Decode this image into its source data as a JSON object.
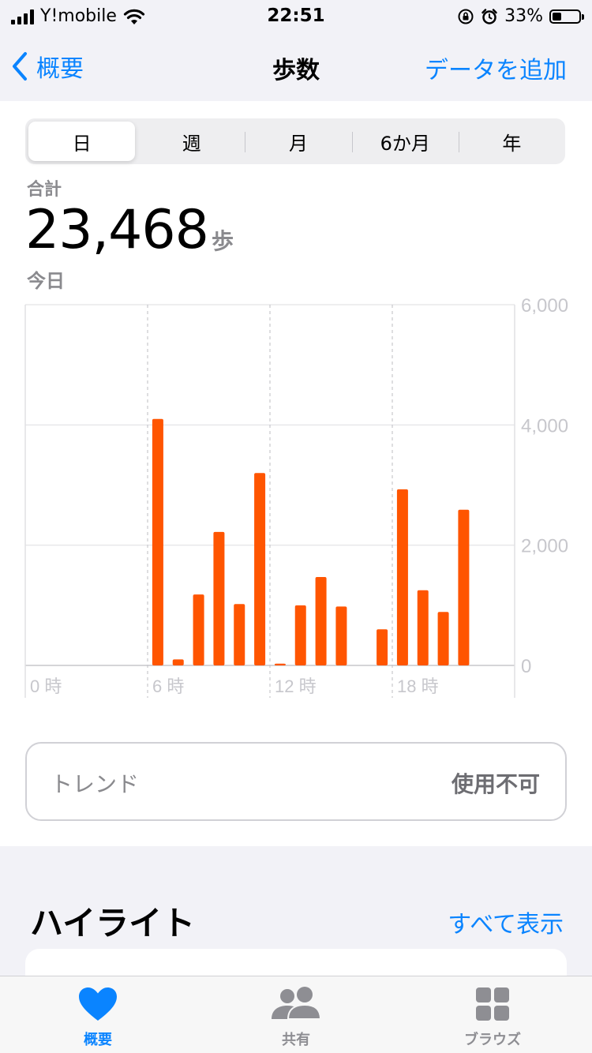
{
  "status_bar": {
    "carrier": "Y!mobile",
    "time": "22:51",
    "battery_percent": "33%",
    "battery_level": 0.33,
    "icons": [
      "signal-icon",
      "wifi-icon",
      "rotation-lock-icon",
      "alarm-icon",
      "battery-icon"
    ]
  },
  "nav": {
    "back_label": "概要",
    "title": "歩数",
    "action_label": "データを追加"
  },
  "segments": [
    {
      "label": "日",
      "active": true
    },
    {
      "label": "週",
      "active": false
    },
    {
      "label": "月",
      "active": false
    },
    {
      "label": "6か月",
      "active": false
    },
    {
      "label": "年",
      "active": false
    }
  ],
  "summary": {
    "label": "合計",
    "value": "23,468",
    "unit": "歩",
    "date": "今日"
  },
  "chart_data": {
    "type": "bar",
    "categories": [
      "0",
      "1",
      "2",
      "3",
      "4",
      "5",
      "6",
      "7",
      "8",
      "9",
      "10",
      "11",
      "12",
      "13",
      "14",
      "15",
      "16",
      "17",
      "18",
      "19",
      "20",
      "21",
      "22",
      "23"
    ],
    "values": [
      0,
      0,
      0,
      0,
      0,
      0,
      4100,
      100,
      1180,
      2220,
      1020,
      3200,
      30,
      1000,
      1470,
      980,
      0,
      600,
      2930,
      1250,
      890,
      2590,
      0,
      0
    ],
    "xticks": [
      "0 時",
      "6 時",
      "12 時",
      "18 時"
    ],
    "yticks": [
      "6,000",
      "4,000",
      "2,000",
      "0"
    ],
    "ylim": [
      0,
      6000
    ],
    "bar_color": "#ff5500",
    "grid": true
  },
  "trend": {
    "label": "トレンド",
    "status": "使用不可"
  },
  "highlights": {
    "title": "ハイライト",
    "show_all": "すべて表示"
  },
  "tab_bar": {
    "items": [
      {
        "label": "概要",
        "icon": "heart-icon",
        "active": true
      },
      {
        "label": "共有",
        "icon": "people-icon",
        "active": false
      },
      {
        "label": "ブラウズ",
        "icon": "grid-icon",
        "active": false
      }
    ]
  },
  "colors": {
    "accent": "#0a84ff",
    "chart_bar": "#ff5500",
    "secondary_text": "#8a8a8e"
  }
}
